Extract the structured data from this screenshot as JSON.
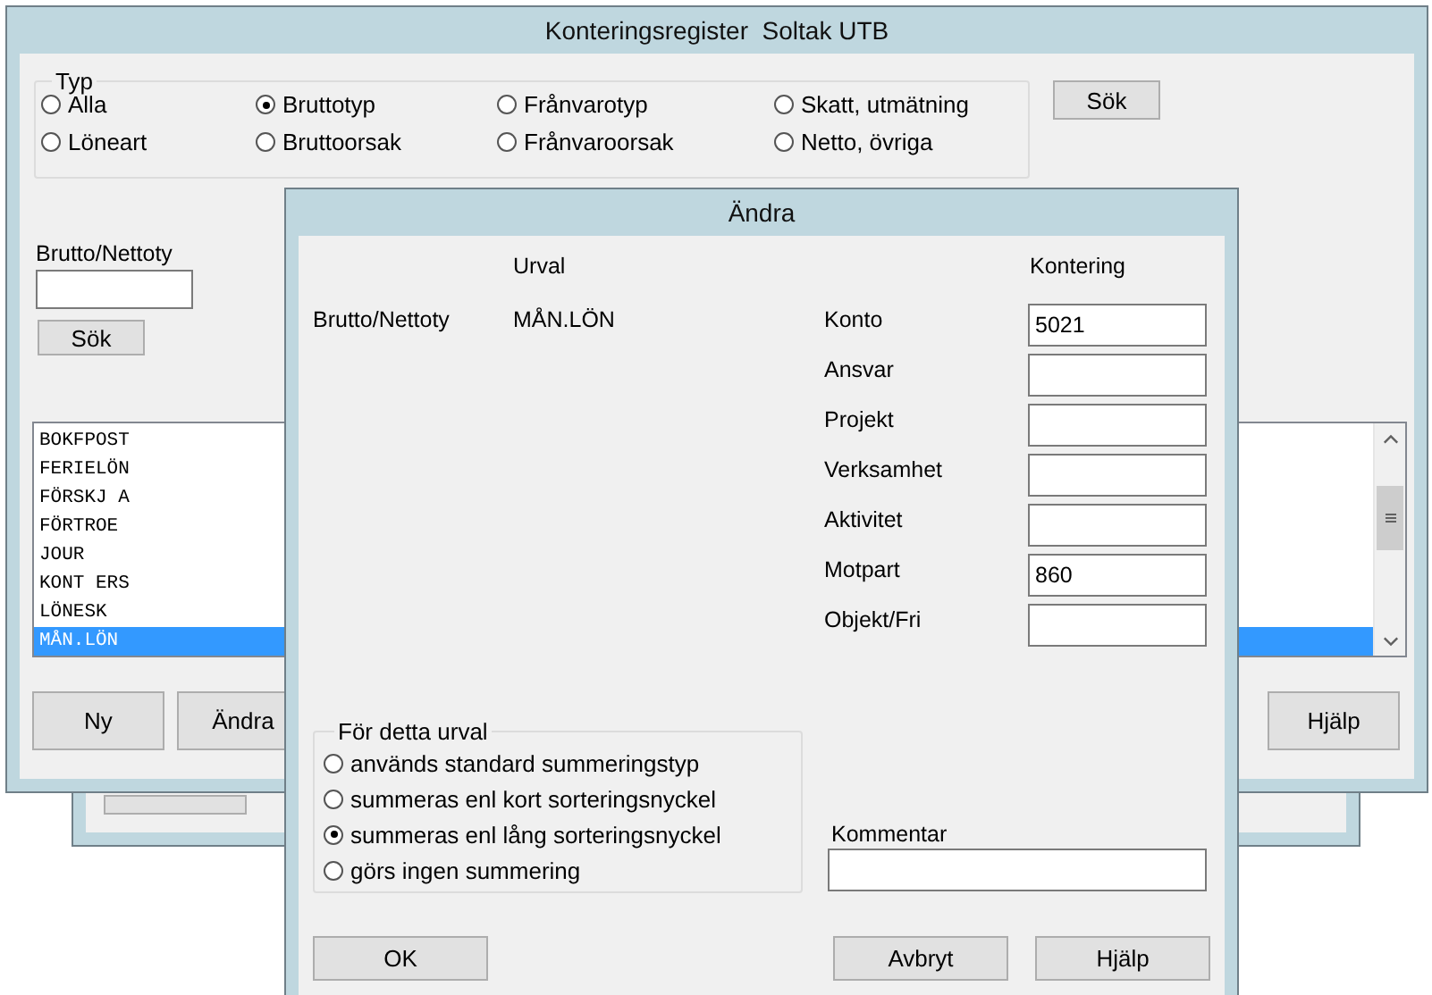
{
  "main_window": {
    "title": "Konteringsregister  Soltak UTB",
    "type_group": {
      "label": "Typ",
      "options": [
        {
          "label": "Alla",
          "selected": false
        },
        {
          "label": "Bruttotyp",
          "selected": true
        },
        {
          "label": "Frånvarotyp",
          "selected": false
        },
        {
          "label": "Skatt, utmätning",
          "selected": false
        },
        {
          "label": "Löneart",
          "selected": false
        },
        {
          "label": "Bruttoorsak",
          "selected": false
        },
        {
          "label": "Frånvaroorsak",
          "selected": false
        },
        {
          "label": "Netto, övriga",
          "selected": false
        }
      ]
    },
    "search_button": "Sök",
    "filter_label": "Brutto/Nettoty",
    "filter_button": "Sök",
    "list_items": [
      {
        "label": "BOKFPOST",
        "selected": false
      },
      {
        "label": "FERIELÖN",
        "selected": false
      },
      {
        "label": "FÖRSKJ A",
        "selected": false
      },
      {
        "label": "FÖRTROE",
        "selected": false
      },
      {
        "label": "JOUR",
        "selected": false
      },
      {
        "label": "KONT ERS",
        "selected": false
      },
      {
        "label": "LÖNESK",
        "selected": false
      },
      {
        "label": "MÅN.LÖN",
        "selected": true
      }
    ],
    "buttons": [
      "Ny",
      "Ändra",
      "Hjälp"
    ]
  },
  "dialog": {
    "title": "Ändra",
    "urval_header": "Urval",
    "kontering_header": "Kontering",
    "urval_label": "Brutto/Nettoty",
    "urval_value": "MÅN.LÖN",
    "fields": [
      {
        "label": "Konto",
        "value": "5021"
      },
      {
        "label": "Ansvar"
      },
      {
        "label": "Projekt"
      },
      {
        "label": "Verksamhet"
      },
      {
        "label": "Aktivitet"
      },
      {
        "label": "Motpart",
        "value": "860"
      },
      {
        "label": "Objekt/Fri"
      }
    ],
    "summary_group": {
      "label": "För detta urval",
      "options": [
        {
          "label": "används standard summeringstyp",
          "selected": false
        },
        {
          "label": "summeras enl kort sorteringsnyckel",
          "selected": false
        },
        {
          "label": "summeras enl lång sorteringsnyckel",
          "selected": true
        },
        {
          "label": "görs ingen summering",
          "selected": false
        }
      ]
    },
    "comment_label": "Kommentar",
    "buttons": [
      "OK",
      "Avbryt",
      "Hjälp"
    ]
  }
}
